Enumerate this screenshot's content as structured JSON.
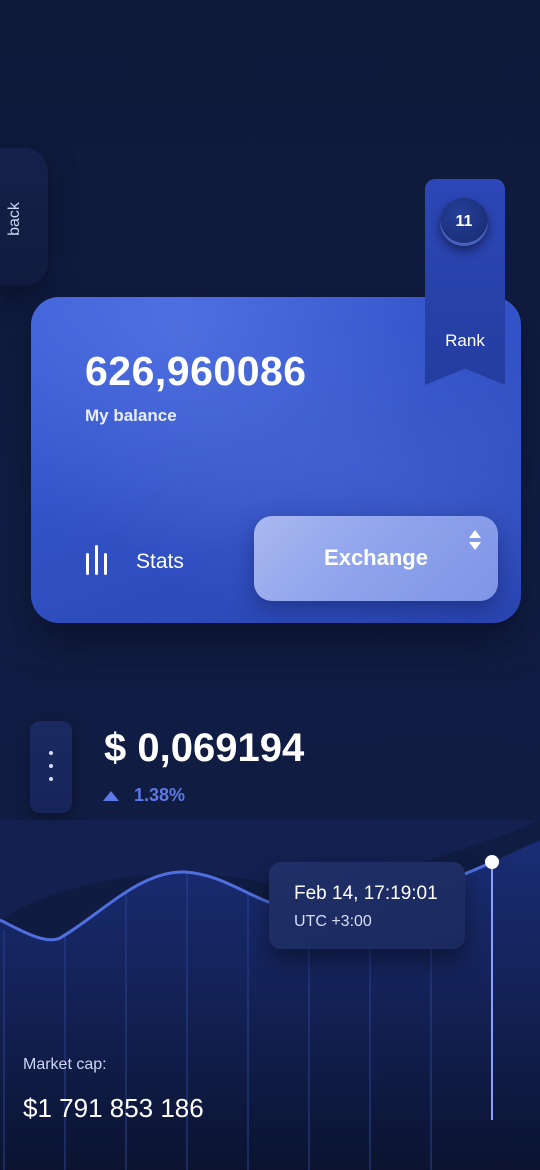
{
  "nav": {
    "back_label": "back"
  },
  "rank": {
    "number": "11",
    "label": "Rank"
  },
  "balance": {
    "value": "626,960086",
    "label": "My balance"
  },
  "actions": {
    "stats_label": "Stats",
    "exchange_label": "Exchange"
  },
  "price": {
    "value": "$ 0,069194",
    "change": "1.38%"
  },
  "tooltip": {
    "date": "Feb 14, 17:19:01",
    "timezone": "UTC +3:00"
  },
  "market": {
    "label": "Market cap:",
    "value": "$1 791 853 186"
  },
  "colors": {
    "accent": "#5c79e6",
    "card": "#3152c6",
    "background": "#0e1838",
    "chart_line": "#4f6fe0"
  },
  "icons": [
    "stats-bars-icon",
    "sort-arrows-icon",
    "menu-dots-icon",
    "up-triangle-icon"
  ]
}
